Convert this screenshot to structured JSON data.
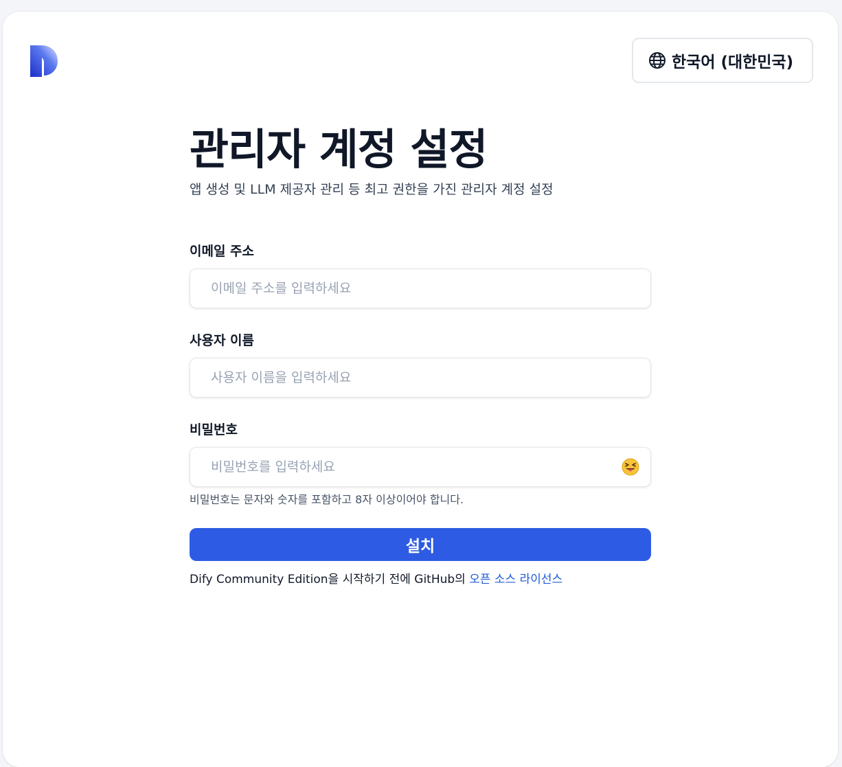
{
  "header": {
    "language_label": "한국어 (대한민국)"
  },
  "page": {
    "title": "관리자 계정 설정",
    "subtitle": "앱 생성 및 LLM 제공자 관리 등 최고 권한을 가진 관리자 계정 설정"
  },
  "form": {
    "email": {
      "label": "이메일 주소",
      "value": "",
      "placeholder": "이메일 주소를 입력하세요"
    },
    "username": {
      "label": "사용자 이름",
      "value": "",
      "placeholder": "사용자 이름을 입력하세요"
    },
    "password": {
      "label": "비밀번호",
      "value": "",
      "placeholder": "비밀번호를 입력하세요",
      "hint": "비밀번호는 문자와 숫자를 포함하고 8자 이상이어야 합니다.",
      "toggle_icon": "squinting-tongue-emoji-icon"
    },
    "submit_label": "설치"
  },
  "footer": {
    "text_prefix": "Dify Community Edition을 시작하기 전에 GitHub의 ",
    "link_label": "오픈 소스 라이선스"
  },
  "colors": {
    "accent": "#2d5be3",
    "link": "#1f5bd6"
  },
  "icons": {
    "logo": "dify-logo-icon",
    "language": "globe-icon"
  }
}
